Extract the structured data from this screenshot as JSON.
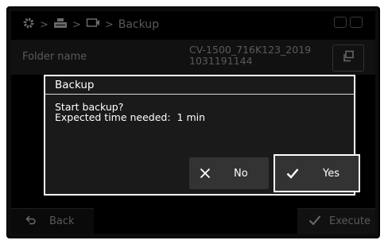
{
  "header": {
    "breadcrumb": {
      "icons": [
        "gear-icon",
        "device-icon",
        "monitor-icon"
      ],
      "separator": ">",
      "current": "Backup"
    }
  },
  "folder": {
    "label": "Folder name",
    "value_line1": "CV-1500_716K123_2019",
    "value_line2": "1031191144",
    "copy_icon": "copy-icon"
  },
  "footer": {
    "back_label": "Back",
    "execute_label": "Execute"
  },
  "dialog": {
    "title": "Backup",
    "message_line1": "Start backup?",
    "message_line2": "Expected time needed:  1 min",
    "no_label": "No",
    "yes_label": "Yes"
  },
  "colors": {
    "screen_bg": "#000000",
    "dialog_bg": "#1a1a1a",
    "button_bg": "#333333",
    "dim_text": "#5a5a5a",
    "text": "#ffffff"
  }
}
